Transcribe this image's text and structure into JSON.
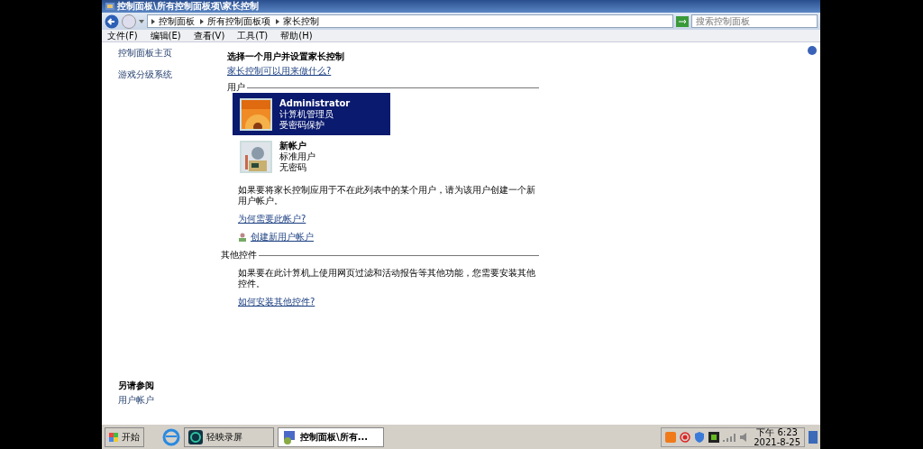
{
  "window": {
    "title": "控制面板\\所有控制面板项\\家长控制"
  },
  "address": {
    "breadcrumbs": [
      "控制面板",
      "所有控制面板项",
      "家长控制"
    ]
  },
  "search": {
    "placeholder": "搜索控制面板"
  },
  "menu": [
    "文件(F)",
    "编辑(E)",
    "查看(V)",
    "工具(T)",
    "帮助(H)"
  ],
  "sidebar": {
    "items": [
      "控制面板主页",
      "游戏分级系统"
    ],
    "see_also": {
      "title": "另请参阅",
      "links": [
        "用户帐户"
      ]
    }
  },
  "main": {
    "heading": "选择一个用户并设置家长控制",
    "help_link": "家长控制可以用来做什么?",
    "users_section": "用户",
    "users": [
      {
        "name": "Administrator",
        "type": "计算机管理员",
        "password": "受密码保护",
        "selected": true
      },
      {
        "name": "新帐户",
        "type": "标准用户",
        "password": "无密码",
        "selected": false
      }
    ],
    "create_note": "如果要将家长控制应用于不在此列表中的某个用户，请为该用户创建一个新用户帐户。",
    "why_link": "为何需要此帐户?",
    "create_link": "创建新用户帐户",
    "other_section": "其他控件",
    "other_note": "如果要在此计算机上使用网页过滤和活动报告等其他功能，您需要安装其他控件。",
    "install_link": "如何安装其他控件?"
  },
  "taskbar": {
    "start": "开始",
    "tasks": [
      {
        "label": "轻映录屏",
        "selected": false
      },
      {
        "label": "控制面板\\所有...",
        "selected": true
      }
    ],
    "time": "下午 6:23",
    "date": "2021-8-25"
  }
}
